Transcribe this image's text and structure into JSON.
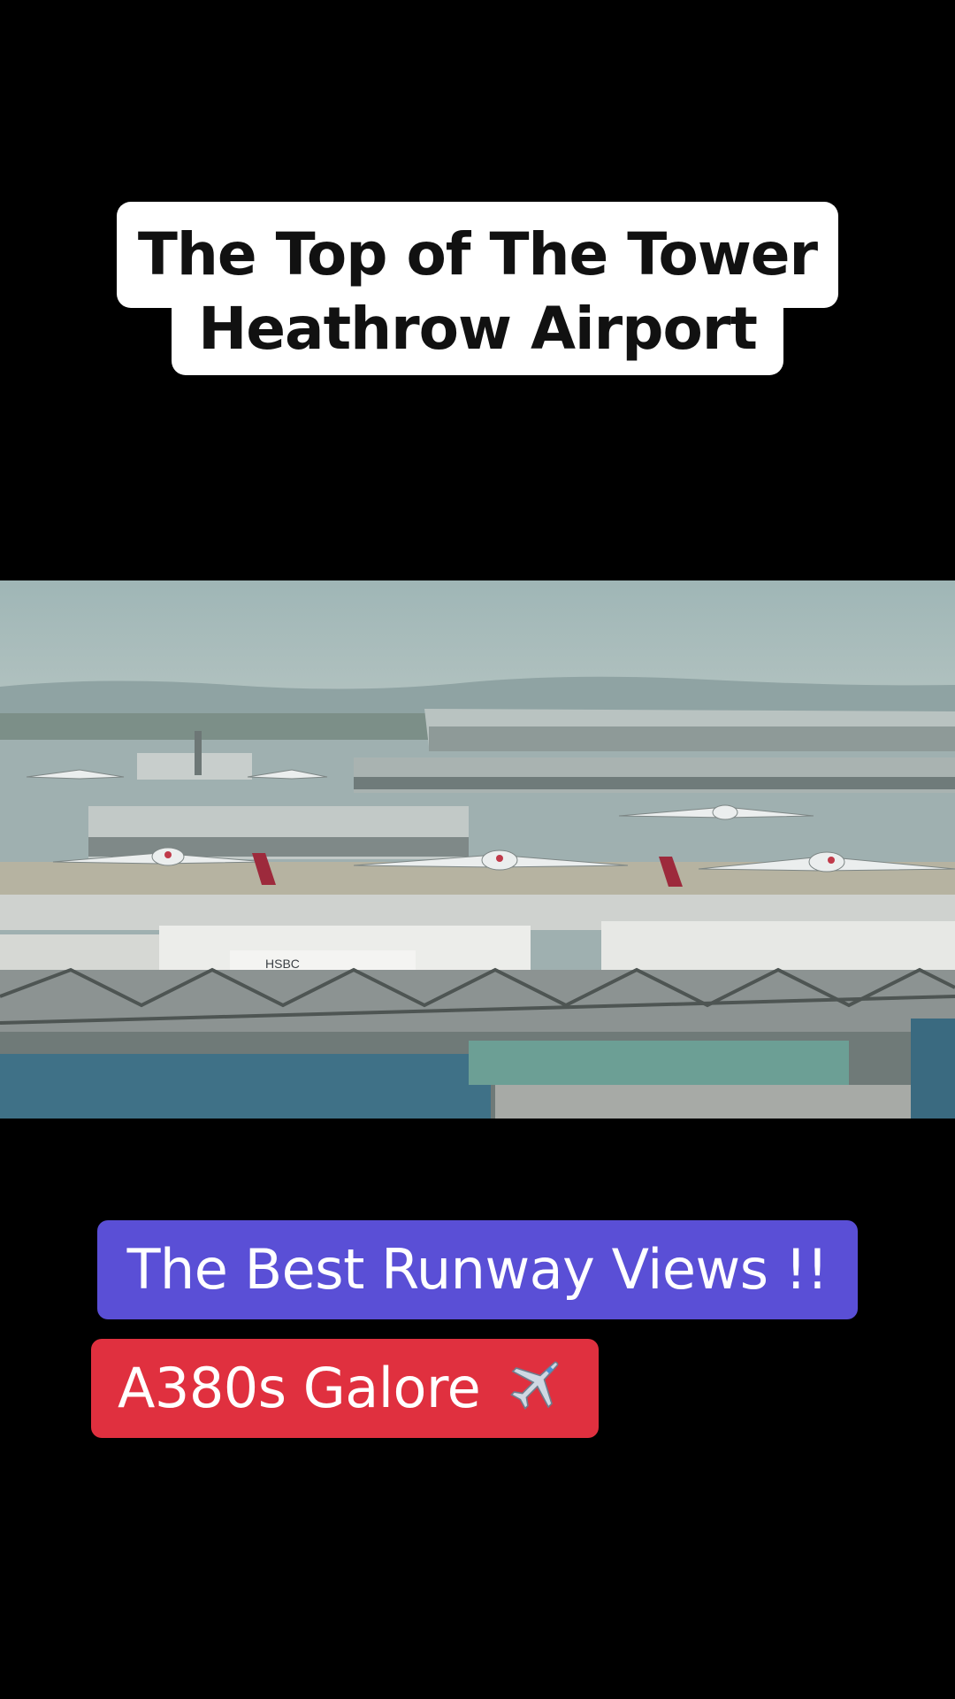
{
  "overlay": {
    "title_line_1": "The Top of The Tower",
    "title_line_2": "Heathrow Airport",
    "caption_1": "The Best Runway Views !!",
    "caption_2": "A380s Galore"
  },
  "icons": {
    "caption_2_icon": "airplane-emoji"
  },
  "photo": {
    "signage": "HSBC"
  },
  "colors": {
    "background": "#000000",
    "title_box": "#ffffff",
    "caption_1_box": "#5a4fd6",
    "caption_2_box": "#e0303f"
  }
}
